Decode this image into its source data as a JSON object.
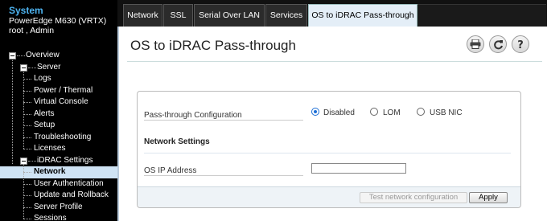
{
  "system": {
    "title": "System",
    "model": "PowerEdge M630 (VRTX)",
    "user": "root , Admin"
  },
  "tree": [
    {
      "label": "Overview",
      "expander": true,
      "selected": false
    },
    {
      "label": "Server",
      "expander": true,
      "selected": false
    },
    {
      "label": "Logs",
      "expander": false,
      "selected": false
    },
    {
      "label": "Power / Thermal",
      "expander": false,
      "selected": false
    },
    {
      "label": "Virtual Console",
      "expander": false,
      "selected": false
    },
    {
      "label": "Alerts",
      "expander": false,
      "selected": false
    },
    {
      "label": "Setup",
      "expander": false,
      "selected": false
    },
    {
      "label": "Troubleshooting",
      "expander": false,
      "selected": false
    },
    {
      "label": "Licenses",
      "expander": false,
      "selected": false
    },
    {
      "label": "iDRAC Settings",
      "expander": true,
      "selected": false
    },
    {
      "label": "Network",
      "expander": false,
      "selected": true
    },
    {
      "label": "User Authentication",
      "expander": false,
      "selected": false
    },
    {
      "label": "Update and Rollback",
      "expander": false,
      "selected": false
    },
    {
      "label": "Server Profile",
      "expander": false,
      "selected": false
    },
    {
      "label": "Sessions",
      "expander": false,
      "selected": false
    }
  ],
  "tabs": [
    {
      "label": "Network",
      "active": false
    },
    {
      "label": "SSL",
      "active": false
    },
    {
      "label": "Serial Over LAN",
      "active": false
    },
    {
      "label": "Services",
      "active": false
    },
    {
      "label": "OS to iDRAC Pass-through",
      "active": true
    }
  ],
  "page": {
    "title": "OS to iDRAC Pass-through",
    "tools": [
      "print-icon",
      "refresh-icon",
      "help-icon"
    ]
  },
  "form": {
    "passthrough_label": "Pass-through Configuration",
    "options": [
      {
        "label": "Disabled",
        "selected": true
      },
      {
        "label": "LOM",
        "selected": false
      },
      {
        "label": "USB NIC",
        "selected": false
      }
    ],
    "network_settings_label": "Network Settings",
    "os_ip_label": "OS IP Address",
    "os_ip_value": "",
    "test_button": "Test network configuration",
    "apply_button": "Apply"
  },
  "colors": {
    "accent": "#4db3f0",
    "selected_bg": "#cfe3f4",
    "radio_on": "#1d6fd6"
  }
}
